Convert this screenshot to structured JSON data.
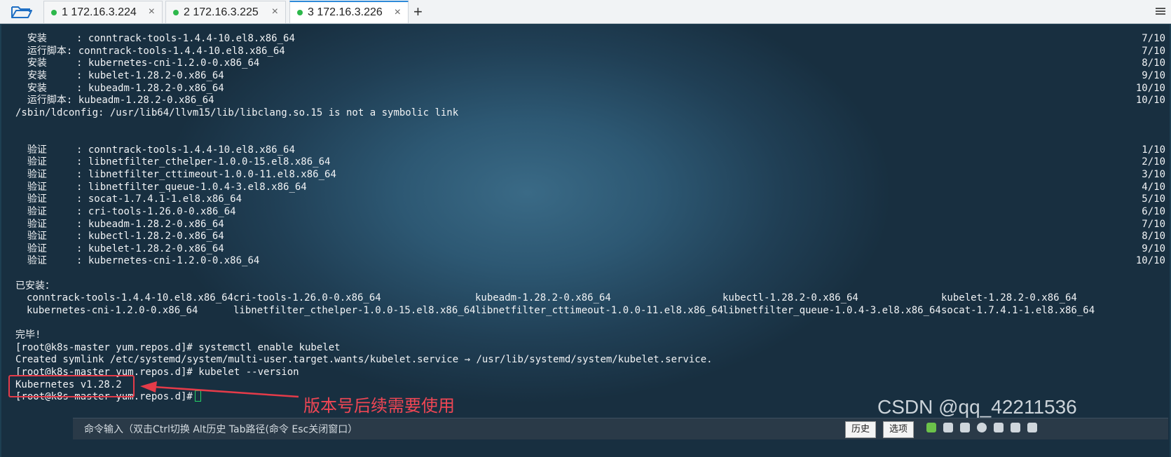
{
  "tabs": [
    {
      "label": "1 172.16.3.224",
      "status_color": "#2db84b",
      "active": false
    },
    {
      "label": "2 172.16.3.225",
      "status_color": "#2db84b",
      "active": false
    },
    {
      "label": "3 172.16.3.226",
      "status_color": "#2db84b",
      "active": true
    }
  ],
  "close_glyph": "×",
  "add_tab_glyph": "+",
  "terminal": {
    "install_lines": [
      {
        "label": "  安装    ",
        "pkg": "conntrack-tools-1.4.4-10.el8.x86_64",
        "progress": "7/10"
      },
      {
        "label": "  运行脚本",
        "pkg": "conntrack-tools-1.4.4-10.el8.x86_64",
        "progress": "7/10"
      },
      {
        "label": "  安装    ",
        "pkg": "kubernetes-cni-1.2.0-0.x86_64",
        "progress": "8/10"
      },
      {
        "label": "  安装    ",
        "pkg": "kubelet-1.28.2-0.x86_64",
        "progress": "9/10"
      },
      {
        "label": "  安装    ",
        "pkg": "kubeadm-1.28.2-0.x86_64",
        "progress": "10/10"
      },
      {
        "label": "  运行脚本",
        "pkg": "kubeadm-1.28.2-0.x86_64",
        "progress": "10/10"
      }
    ],
    "ldconfig_line": "/sbin/ldconfig: /usr/lib64/llvm15/lib/libclang.so.15 is not a symbolic link",
    "verify_lines": [
      {
        "label": "  验证    ",
        "pkg": "conntrack-tools-1.4.4-10.el8.x86_64",
        "progress": "1/10"
      },
      {
        "label": "  验证    ",
        "pkg": "libnetfilter_cthelper-1.0.0-15.el8.x86_64",
        "progress": "2/10"
      },
      {
        "label": "  验证    ",
        "pkg": "libnetfilter_cttimeout-1.0.0-11.el8.x86_64",
        "progress": "3/10"
      },
      {
        "label": "  验证    ",
        "pkg": "libnetfilter_queue-1.0.4-3.el8.x86_64",
        "progress": "4/10"
      },
      {
        "label": "  验证    ",
        "pkg": "socat-1.7.4.1-1.el8.x86_64",
        "progress": "5/10"
      },
      {
        "label": "  验证    ",
        "pkg": "cri-tools-1.26.0-0.x86_64",
        "progress": "6/10"
      },
      {
        "label": "  验证    ",
        "pkg": "kubeadm-1.28.2-0.x86_64",
        "progress": "7/10"
      },
      {
        "label": "  验证    ",
        "pkg": "kubectl-1.28.2-0.x86_64",
        "progress": "8/10"
      },
      {
        "label": "  验证    ",
        "pkg": "kubelet-1.28.2-0.x86_64",
        "progress": "9/10"
      },
      {
        "label": "  验证    ",
        "pkg": "kubernetes-cni-1.2.0-0.x86_64",
        "progress": "10/10"
      }
    ],
    "installed_header": "已安装：",
    "installed_rows": [
      [
        "conntrack-tools-1.4.4-10.el8.x86_64",
        "cri-tools-1.26.0-0.x86_64",
        "kubeadm-1.28.2-0.x86_64",
        "kubectl-1.28.2-0.x86_64",
        "kubelet-1.28.2-0.x86_64"
      ],
      [
        "kubernetes-cni-1.2.0-0.x86_64",
        "libnetfilter_cthelper-1.0.0-15.el8.x86_64",
        "libnetfilter_cttimeout-1.0.0-11.el8.x86_64",
        "libnetfilter_queue-1.0.4-3.el8.x86_64",
        "socat-1.7.4.1-1.el8.x86_64"
      ]
    ],
    "done_line": "完毕!",
    "prompt1": "[root@k8s-master yum.repos.d]# systemctl enable kubelet",
    "symlink_line": "Created symlink /etc/systemd/system/multi-user.target.wants/kubelet.service → /usr/lib/systemd/system/kubelet.service.",
    "prompt2": "[root@k8s-master yum.repos.d]# kubelet --version",
    "version_output": "Kubernetes v1.28.2",
    "prompt3": "[root@k8s-master yum.repos.d]# "
  },
  "annotation": "版本号后续需要使用",
  "watermark": "CSDN @qq_42211536",
  "command_bar": {
    "hint": "命令输入（双击Ctrl切换 Alt历史 Tab路径(命令 Esc关闭窗口）",
    "history_label": "历史",
    "options_label": "选项"
  },
  "colors": {
    "highlight": "#e43b49",
    "annotation": "#ef4654",
    "cursor": "#25d366",
    "tab_active_accent": "#2e8ad8"
  }
}
